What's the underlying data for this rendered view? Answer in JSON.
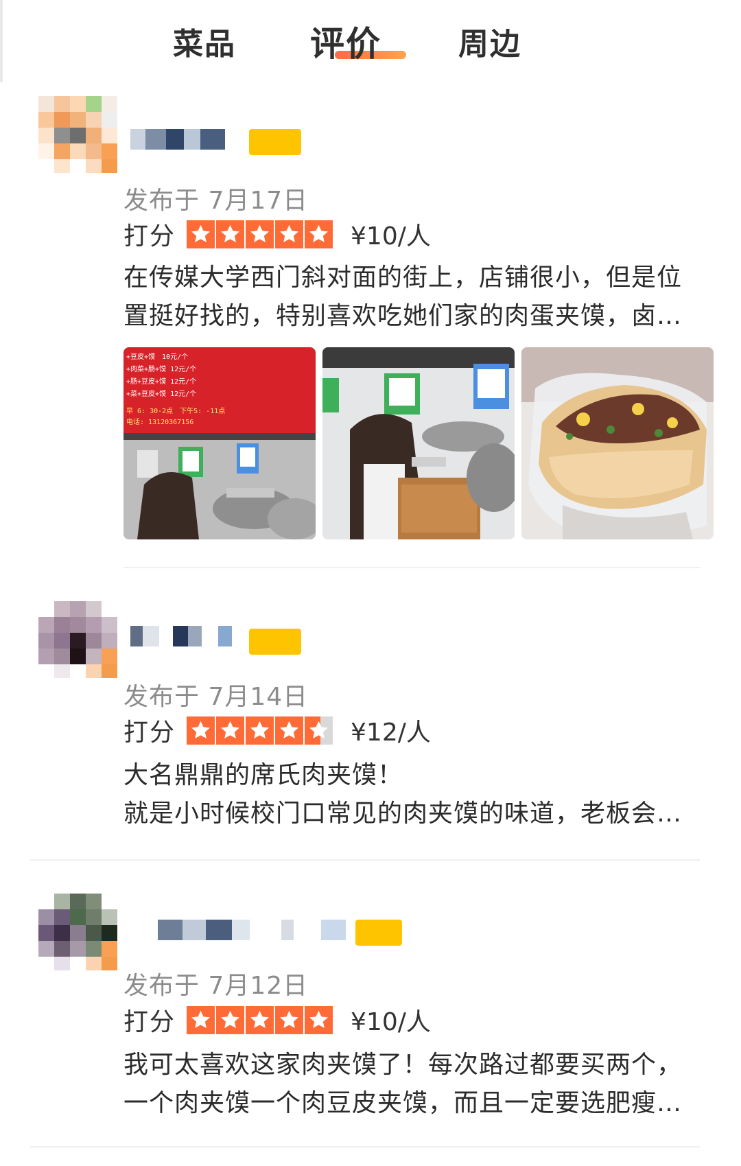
{
  "tabs": [
    {
      "label": "菜品",
      "active": false
    },
    {
      "label": "评价",
      "active": true
    },
    {
      "label": "周边",
      "active": false
    }
  ],
  "accent_color": "#ff6b36",
  "reviews": [
    {
      "date": "发布于 7月17日",
      "rating_label": "打分",
      "stars": 5,
      "price": "¥10/人",
      "text_lines": [
        "在传媒大学西门斜对面的街上，店铺很小，但是位",
        "置挺好找的，特别喜欢吃她们家的肉蛋夹馍，卤…"
      ],
      "photos": [
        "menu-board-photo",
        "cooking-photo",
        "meat-sandwich-photo"
      ],
      "menu_board": {
        "rows": [
          "+豆皮+馍　10元/个",
          "+肉菜+肠+馍 12元/个",
          "+肠+豆皮+馍 12元/个",
          "+菜+豆皮+馍 12元/个"
        ],
        "hours": "早 6: 30-2点　下午5: -11点",
        "phone": "电话: 13120367156"
      }
    },
    {
      "date": "发布于 7月14日",
      "rating_label": "打分",
      "stars": 4.5,
      "price": "¥12/人",
      "text_lines": [
        "大名鼎鼎的席氏肉夹馍！",
        "就是小时候校门口常见的肉夹馍的味道，老板会…"
      ]
    },
    {
      "date": "发布于 7月12日",
      "rating_label": "打分",
      "stars": 5,
      "price": "¥10/人",
      "text_lines": [
        "我可太喜欢这家肉夹馍了！每次路过都要买两个，",
        "一个肉夹馍一个肉豆皮夹馍，而且一定要选肥瘦…"
      ]
    }
  ]
}
